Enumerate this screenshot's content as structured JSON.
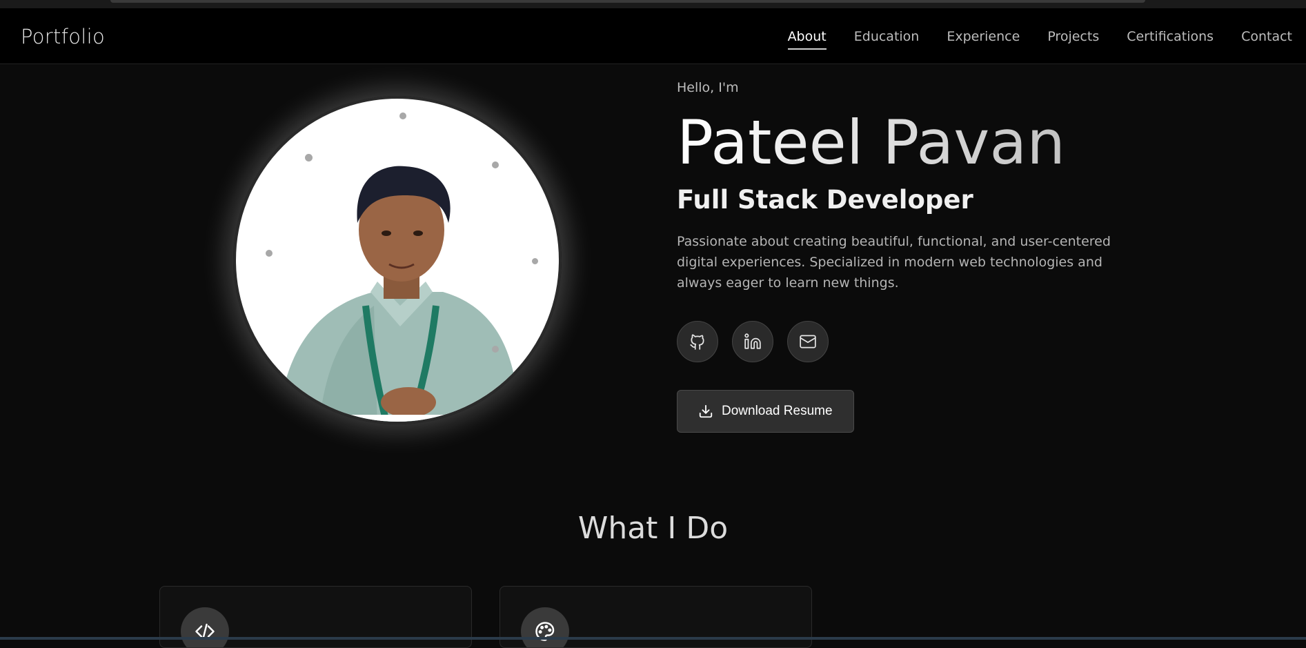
{
  "brand": "Portfolio",
  "nav": {
    "items": [
      "About",
      "Education",
      "Experience",
      "Projects",
      "Certifications",
      "Contact"
    ],
    "active": "About"
  },
  "hero": {
    "greeting": "Hello, I'm",
    "name": "Pateel Pavan",
    "role": "Full Stack Developer",
    "bio": "Passionate about creating beautiful, functional, and user-centered digital experiences. Specialized in modern web technologies and always eager to learn new things.",
    "socials": [
      {
        "icon": "github-icon"
      },
      {
        "icon": "linkedin-icon"
      },
      {
        "icon": "mail-icon"
      }
    ],
    "resume_label": "Download Resume"
  },
  "services": {
    "title": "What I Do",
    "cards": [
      {
        "icon": "code-icon"
      },
      {
        "icon": "palette-icon"
      }
    ]
  },
  "colors": {
    "background": "#0b0b0b",
    "navbar": "#000000",
    "accent_button": "#2f2f2f"
  }
}
